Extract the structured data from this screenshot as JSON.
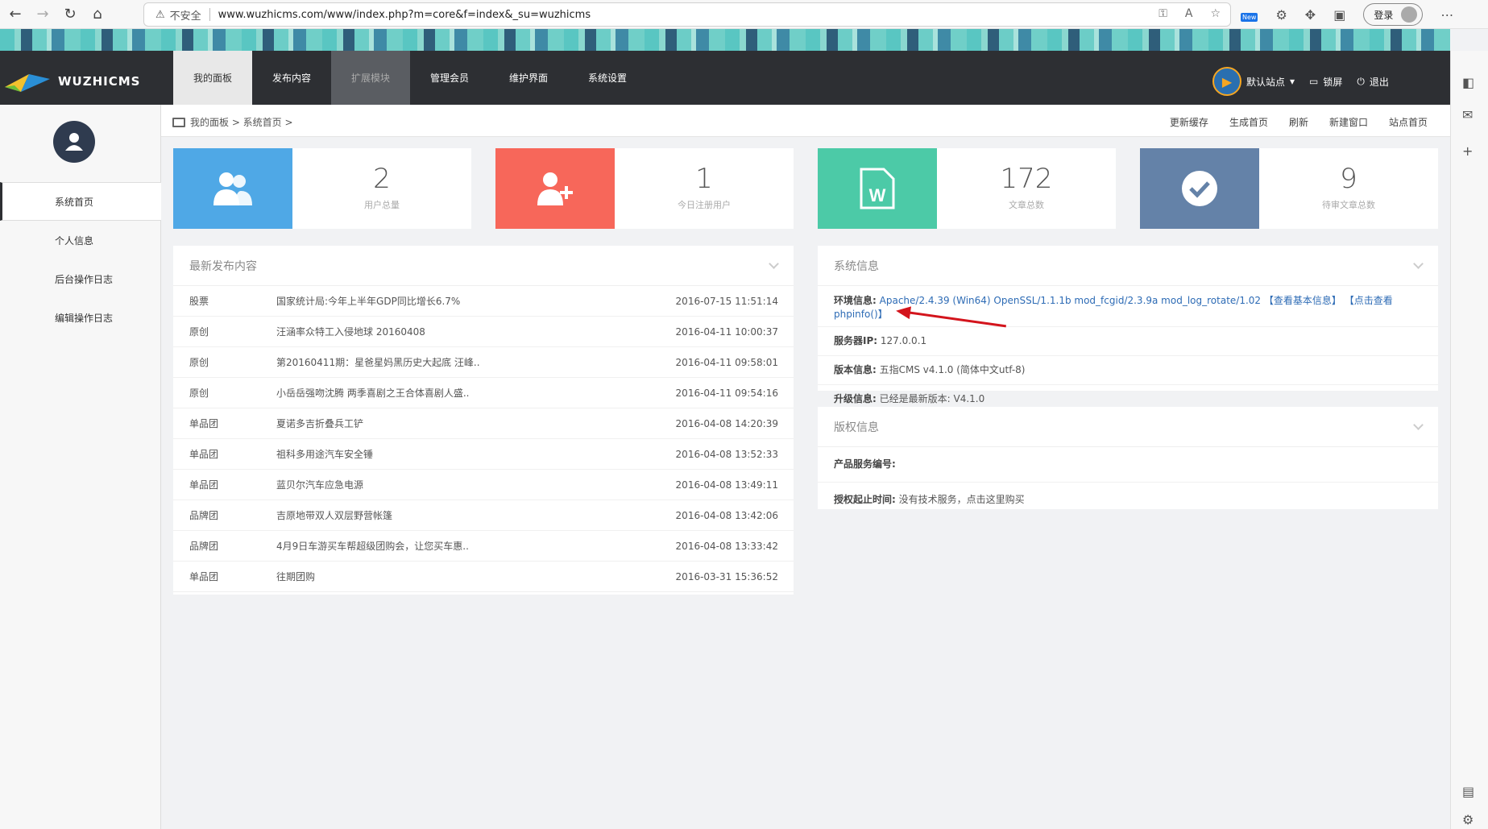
{
  "browser": {
    "insecure_label": "不安全",
    "url": "www.wuzhicms.com/www/index.php?m=core&f=index&_su=wuzhicms",
    "new_badge": "New",
    "login_label": "登录"
  },
  "app": {
    "logo_text": "WUZHICMS",
    "nav": [
      "我的面板",
      "发布内容",
      "扩展模块",
      "管理会员",
      "维护界面",
      "系统设置"
    ],
    "site_label": "默认站点",
    "lock_label": "锁屏",
    "logout_label": "退出"
  },
  "sidebar": {
    "items": [
      "系统首页",
      "个人信息",
      "后台操作日志",
      "编辑操作日志"
    ]
  },
  "breadcrumb": {
    "text": "我的面板 > 系统首页 >",
    "actions": [
      "更新缓存",
      "生成首页",
      "刷新",
      "新建窗口",
      "站点首页"
    ]
  },
  "stats": [
    {
      "value": "2",
      "label": "用户总量",
      "color": "#4fa8e6"
    },
    {
      "value": "1",
      "label": "今日注册用户",
      "color": "#f7675a"
    },
    {
      "value": "172",
      "label": "文章总数",
      "color": "#4ccaa7"
    },
    {
      "value": "9",
      "label": "待审文章总数",
      "color": "#6482a8"
    }
  ],
  "latest": {
    "title": "最新发布内容",
    "rows": [
      {
        "cat": "股票",
        "title": "国家统计局:今年上半年GDP同比增长6.7%",
        "date": "2016-07-15 11:51:14"
      },
      {
        "cat": "原创",
        "title": "汪涵率众特工入侵地球 20160408",
        "date": "2016-04-11 10:00:37"
      },
      {
        "cat": "原创",
        "title": "第20160411期：星爸星妈黑历史大起底 汪峰..",
        "date": "2016-04-11 09:58:01"
      },
      {
        "cat": "原创",
        "title": "小岳岳强吻沈腾 两季喜剧之王合体喜剧人盛..",
        "date": "2016-04-11 09:54:16"
      },
      {
        "cat": "单品团",
        "title": "夏诺多吉折叠兵工铲",
        "date": "2016-04-08 14:20:39"
      },
      {
        "cat": "单品团",
        "title": "祖科多用途汽车安全锤",
        "date": "2016-04-08 13:52:33"
      },
      {
        "cat": "单品团",
        "title": "蓝贝尔汽车应急电源",
        "date": "2016-04-08 13:49:11"
      },
      {
        "cat": "品牌团",
        "title": "吉原地带双人双层野营帐篷",
        "date": "2016-04-08 13:42:06"
      },
      {
        "cat": "品牌团",
        "title": "4月9日车游买车帮超级团购会，让您买车惠..",
        "date": "2016-04-08 13:33:42"
      },
      {
        "cat": "单品团",
        "title": "往期团购",
        "date": "2016-03-31 15:36:52"
      }
    ]
  },
  "sysinfo": {
    "title": "系统信息",
    "env_label": "环境信息:",
    "env_value": "Apache/2.4.39 (Win64) OpenSSL/1.1.1b mod_fcgid/2.3.9a mod_log_rotate/1.02",
    "env_link1": "【查看基本信息】",
    "env_link2": "【点击查看phpinfo()】",
    "ip_label": "服务器IP:",
    "ip_value": "127.0.0.1",
    "ver_label": "版本信息:",
    "ver_value": "五指CMS v4.1.0 (简体中文utf-8)",
    "upgrade_label": "升级信息:",
    "upgrade_value": "已经是最新版本: V4.1.0"
  },
  "copyright": {
    "title": "版权信息",
    "serial_label": "产品服务编号:",
    "auth_label": "授权起止时间:",
    "auth_value": "没有技术服务，点击这里购买"
  }
}
